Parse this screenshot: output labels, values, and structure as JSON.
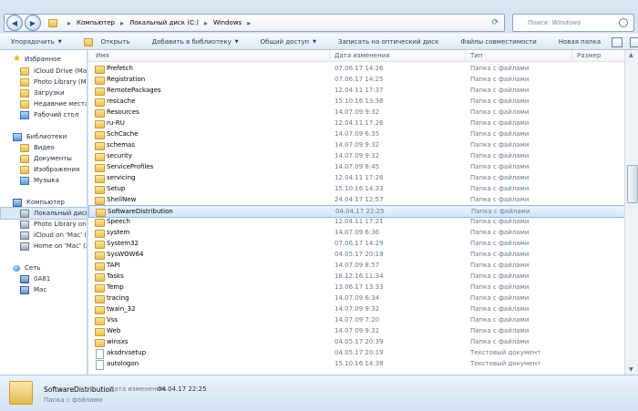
{
  "address": {
    "crumbs": [
      "Компьютер",
      "Локальный диск (C:)",
      "Windows"
    ],
    "search_placeholder": "Поиск: Windows"
  },
  "toolbar": {
    "organize": "Упорядочить",
    "open": "Открыть",
    "add_to_library": "Добавить в библиотеку",
    "share": "Общий доступ",
    "burn": "Записать на оптический диск",
    "compat_files": "Файлы совместимости",
    "new_folder": "Новая папка"
  },
  "sidebar": {
    "items": [
      {
        "label": "Избранное",
        "icon": "star-icon",
        "type": "group"
      },
      {
        "label": "iCloud Drive (Mac)",
        "icon": "folder-icon"
      },
      {
        "label": "Photo Library (Mac)",
        "icon": "folder-icon"
      },
      {
        "label": "Загрузки",
        "icon": "folder-icon"
      },
      {
        "label": "Недавние места",
        "icon": "folder-icon"
      },
      {
        "label": "Рабочий стол",
        "icon": "desktop-icon"
      },
      {
        "label": "Библиотеки",
        "icon": "library-icon",
        "type": "group"
      },
      {
        "label": "Видео",
        "icon": "folder-icon"
      },
      {
        "label": "Документы",
        "icon": "folder-icon"
      },
      {
        "label": "Изображения",
        "icon": "folder-icon"
      },
      {
        "label": "Музыка",
        "icon": "music-icon"
      },
      {
        "label": "Компьютер",
        "icon": "computer-icon",
        "type": "group"
      },
      {
        "label": "Локальный диск (C:)",
        "icon": "drive-icon"
      },
      {
        "label": "Photo Library on 'M",
        "icon": "drive-icon"
      },
      {
        "label": "iCloud on 'Mac' (Y:)",
        "icon": "drive-icon"
      },
      {
        "label": "Home on 'Mac' (Z:)",
        "icon": "drive-icon"
      },
      {
        "label": "Сеть",
        "icon": "network-icon",
        "type": "group"
      },
      {
        "label": "0A81",
        "icon": "monitor-icon"
      },
      {
        "label": "Mac",
        "icon": "monitor-icon"
      }
    ]
  },
  "columns": {
    "name": "Имя",
    "date": "Дата изменения",
    "type": "Тип",
    "size": "Размер"
  },
  "rows": [
    {
      "name": "Prefetch",
      "date": "07.06.17 14:26",
      "type": "Папка с файлами",
      "kind": "folder"
    },
    {
      "name": "Registration",
      "date": "07.06.17 14:25",
      "type": "Папка с файлами",
      "kind": "folder"
    },
    {
      "name": "RemotePackages",
      "date": "12.04.11 17:37",
      "type": "Папка с файлами",
      "kind": "folder"
    },
    {
      "name": "rescache",
      "date": "15.10.16 13:36",
      "type": "Папка с файлами",
      "kind": "folder"
    },
    {
      "name": "Resources",
      "date": "14.07.09 9:32",
      "type": "Папка с файлами",
      "kind": "folder"
    },
    {
      "name": "ru-RU",
      "date": "12.04.11 17:26",
      "type": "Папка с файлами",
      "kind": "folder"
    },
    {
      "name": "SchCache",
      "date": "14.07.09 6:35",
      "type": "Папка с файлами",
      "kind": "folder"
    },
    {
      "name": "schemas",
      "date": "14.07.09 9:32",
      "type": "Папка с файлами",
      "kind": "folder"
    },
    {
      "name": "security",
      "date": "14.07.09 9:32",
      "type": "Папка с файлами",
      "kind": "folder"
    },
    {
      "name": "ServiceProfiles",
      "date": "14.07.09 8:45",
      "type": "Папка с файлами",
      "kind": "folder"
    },
    {
      "name": "servicing",
      "date": "12.04.11 17:26",
      "type": "Папка с файлами",
      "kind": "folder"
    },
    {
      "name": "Setup",
      "date": "15.10.16 14:33",
      "type": "Папка с файлами",
      "kind": "folder"
    },
    {
      "name": "ShellNew",
      "date": "24.04.17 12:57",
      "type": "Папка с файлами",
      "kind": "folder"
    },
    {
      "name": "SoftwareDistribution",
      "date": "04.04.17 22:25",
      "type": "Папка с файлами",
      "kind": "folder"
    },
    {
      "name": "Speech",
      "date": "12.04.11 17:21",
      "type": "Папка с файлами",
      "kind": "folder"
    },
    {
      "name": "system",
      "date": "14.07.09 6:36",
      "type": "Папка с файлами",
      "kind": "folder"
    },
    {
      "name": "System32",
      "date": "07.06.17 14:29",
      "type": "Папка с файлами",
      "kind": "folder"
    },
    {
      "name": "SysWOW64",
      "date": "04.05.17 20:19",
      "type": "Папка с файлами",
      "kind": "folder"
    },
    {
      "name": "TAPI",
      "date": "14.07.09 8:57",
      "type": "Папка с файлами",
      "kind": "folder"
    },
    {
      "name": "Tasks",
      "date": "18.12.16 11:34",
      "type": "Папка с файлами",
      "kind": "folder"
    },
    {
      "name": "Temp",
      "date": "13.06.17 13:33",
      "type": "Папка с файлами",
      "kind": "folder"
    },
    {
      "name": "tracing",
      "date": "14.07.09 6:34",
      "type": "Папка с файлами",
      "kind": "folder"
    },
    {
      "name": "twain_32",
      "date": "14.07.09 9:32",
      "type": "Папка с файлами",
      "kind": "folder"
    },
    {
      "name": "Vss",
      "date": "14.07.09 7:20",
      "type": "Папка с файлами",
      "kind": "folder"
    },
    {
      "name": "Web",
      "date": "14.07.09 9:32",
      "type": "Папка с файлами",
      "kind": "folder"
    },
    {
      "name": "winsxs",
      "date": "04.05.17 20:39",
      "type": "Папка с файлами",
      "kind": "folder"
    },
    {
      "name": "aksdrvsetup",
      "date": "04.05.17 20:19",
      "type": "Текстовый документ",
      "kind": "doc"
    },
    {
      "name": "autologon",
      "date": "15.10.16 14:38",
      "type": "Текстовый документ",
      "kind": "doc"
    }
  ],
  "selected_row": 13,
  "details": {
    "name": "SoftwareDistribution",
    "date_label": "Дата изменения:",
    "date_value": "04.04.17 22:25",
    "type": "Папка с файлами"
  }
}
